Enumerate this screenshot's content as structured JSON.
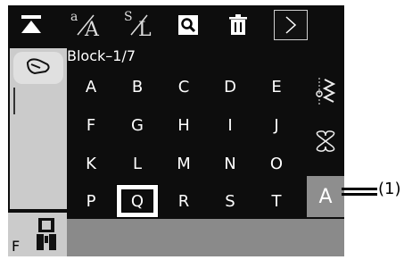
{
  "toolbar": {
    "font_small_a": "a",
    "font_big_a": "A",
    "font_small_s": "S",
    "font_big_l": "L"
  },
  "block": {
    "label": "Block–1/7"
  },
  "keys": [
    "A",
    "B",
    "C",
    "D",
    "E",
    "F",
    "G",
    "H",
    "I",
    "J",
    "K",
    "L",
    "M",
    "N",
    "O",
    "P",
    "Q",
    "R",
    "S",
    "T"
  ],
  "selected_key": "Q",
  "side": {
    "font_button": "A"
  },
  "foot": {
    "label": "F"
  },
  "callout": {
    "label": "(1)"
  },
  "colors": {
    "screen": "#0d0d0d",
    "panel": "#cbcbcb",
    "accent_button": "#8e8e8e",
    "status_bar": "#8a8a8a"
  }
}
